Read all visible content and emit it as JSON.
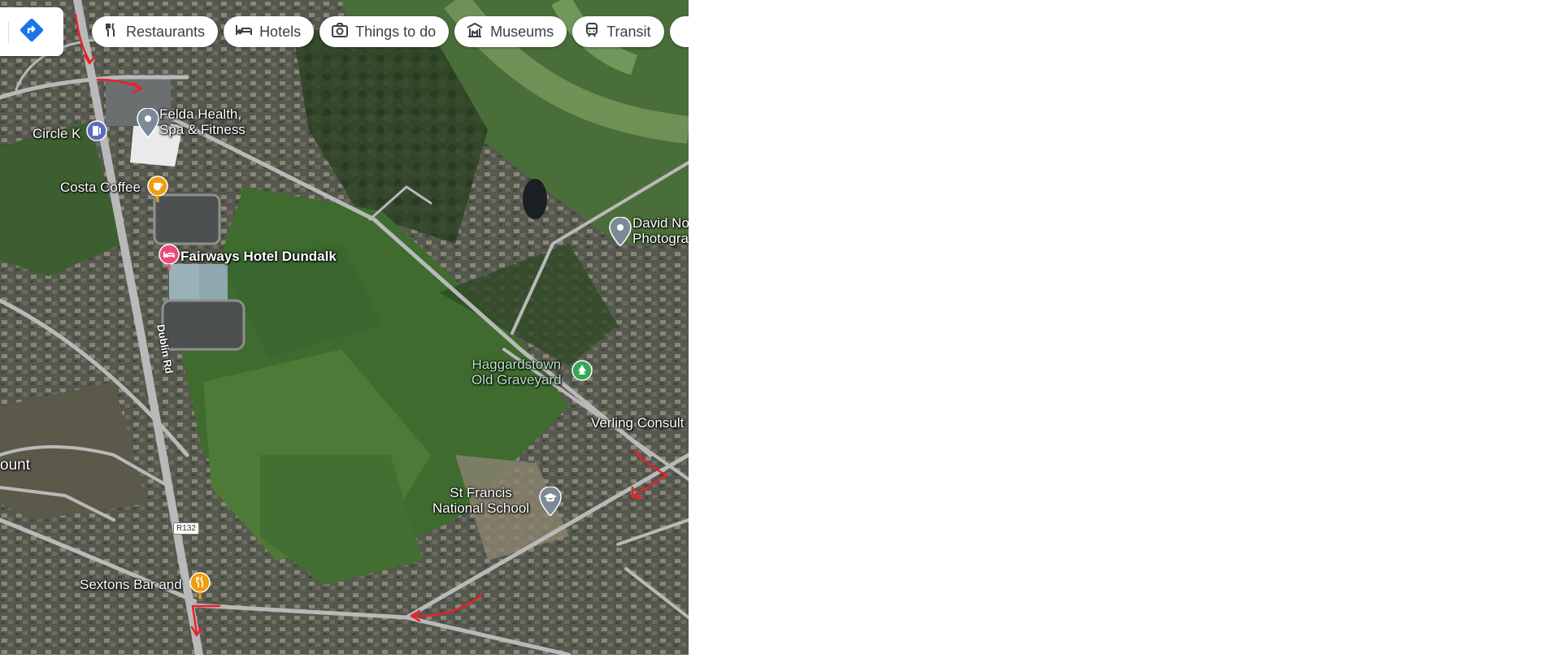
{
  "toolbar": {
    "directions_icon": "directions-icon",
    "chips": [
      {
        "label": "Restaurants",
        "icon": "fork-knife-icon"
      },
      {
        "label": "Hotels",
        "icon": "bed-icon"
      },
      {
        "label": "Things to do",
        "icon": "camera-icon"
      },
      {
        "label": "Museums",
        "icon": "museum-icon"
      },
      {
        "label": "Transit",
        "icon": "train-icon"
      }
    ]
  },
  "places": {
    "felda": "Felda Health,\nSpa & Fitness",
    "circle_k": "Circle K",
    "costa": "Costa Coffee",
    "fairways": "Fairways Hotel Dundalk",
    "david": "David No\nPhotogra",
    "haggardstown": "Haggardstown\nOld Graveyard",
    "verling": "Verling Consult",
    "st_francis": "St Francis\nNational School",
    "sextons": "Sextons Bar and",
    "edge_left": "ount"
  },
  "roads": {
    "dublin_rd": "Dublin Rd",
    "r132": "R132"
  },
  "colors": {
    "route_arrow": "#e8212b",
    "pin_gray": "#7b8a99",
    "pin_orange": "#f29d0c",
    "pin_pink": "#e84d7b",
    "pin_green": "#34a853",
    "pin_purple": "#5c6bc0",
    "directions_blue": "#1a73e8"
  }
}
